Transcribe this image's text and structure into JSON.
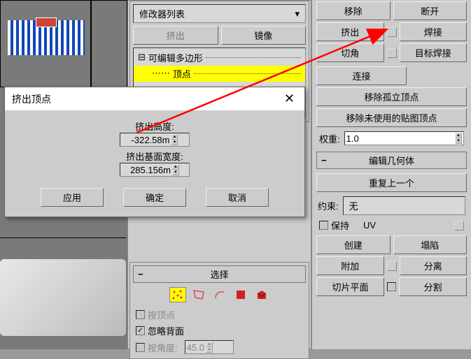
{
  "viewport": {
    "bg_color": "#7a7a7a"
  },
  "modifier_list_label": "修改器列表",
  "modifier_dropdown_value": "",
  "btn_extrude_top": "挤出",
  "btn_mirror": "镜像",
  "tree": {
    "root": "可编辑多边形",
    "child_vertex": "顶点",
    "highlight_color": "#ffff00"
  },
  "dialog": {
    "title": "挤出顶点",
    "label_height": "挤出高度:",
    "value_height": "-322.58m",
    "label_base_width": "挤出基面宽度:",
    "value_base_width": "285.156m",
    "btn_apply": "应用",
    "btn_ok": "确定",
    "btn_cancel": "取消"
  },
  "selection": {
    "section_label": "选择",
    "icons": [
      "vertex",
      "edge",
      "border",
      "polygon",
      "element"
    ],
    "by_vertex": "按顶点",
    "ignore_backface": "忽略背面",
    "by_angle": "按角度:",
    "angle_value": "45.0"
  },
  "right_panel": {
    "btn_remove": "移除",
    "btn_break": "断开",
    "btn_extrude": "挤出",
    "btn_weld": "焊接",
    "btn_chamfer": "切角",
    "btn_target_weld": "目标焊接",
    "btn_connect": "连接",
    "btn_remove_isolated": "移除孤立顶点",
    "btn_remove_unused_map": "移除未使用的贴图顶点",
    "label_weight": "权重:",
    "weight_value": "1.0",
    "section_edit_geom": "编辑几何体",
    "btn_repeat_last": "重复上一个",
    "label_constraint": "约束:",
    "constraint_value": "无",
    "cb_preserve": "保持",
    "cb_uv": "UV",
    "btn_create": "创建",
    "btn_collapse": "塌陷",
    "btn_attach": "附加",
    "btn_detach": "分离",
    "btn_slice_plane": "切片平面",
    "btn_slice": "分割"
  }
}
